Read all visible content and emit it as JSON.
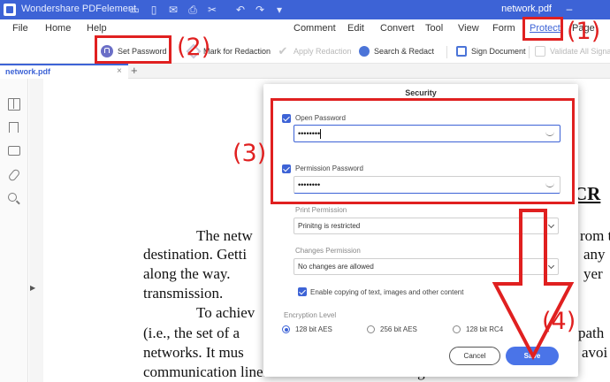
{
  "window": {
    "app_title": "Wondershare PDFelement",
    "doc_title": "network.pdf",
    "quick_access_icons": [
      "folder-icon",
      "save-icon",
      "mail-icon",
      "print-icon",
      "cut-icon",
      "undo-icon",
      "redo-icon",
      "customize-icon"
    ]
  },
  "menu": {
    "file": "File",
    "home": "Home",
    "help": "Help",
    "comment": "Comment",
    "edit": "Edit",
    "convert": "Convert",
    "tool": "Tool",
    "view": "View",
    "form": "Form",
    "protect": "Protect",
    "page": "Page"
  },
  "toolbar": {
    "set_password": "Set Password",
    "mark_redaction": "Mark for Redaction",
    "apply_redaction": "Apply Redaction",
    "search_redact": "Search & Redact",
    "sign_document": "Sign Document",
    "validate_signatures": "Validate All Signa"
  },
  "tabs": {
    "active_doc": "network.pdf",
    "close": "×",
    "add": "+"
  },
  "document": {
    "heading_fragment": "CR",
    "lines": [
      "The netw",
      "destination. Getti",
      "along  the  way.",
      "transmission.",
      "To achiev",
      "(i.e., the set of a",
      "networks. It mus",
      "communication lines and routers while leaving others idle."
    ],
    "right_fragments": [
      "rom t",
      "any",
      "yer",
      "path",
      "avoi"
    ]
  },
  "dialog": {
    "title": "Security",
    "open_password": {
      "label": "Open Password",
      "value": "••••••••"
    },
    "permission_password": {
      "label": "Permission Password",
      "value": "••••••••"
    },
    "print_permission": {
      "label": "Print Permission",
      "value": "Prinitng is restricted"
    },
    "changes_permission": {
      "label": "Changes Permission",
      "value": "No changes are allowed"
    },
    "copy_option": "Enable copying of text, images and other content",
    "encryption": {
      "label": "Encryption Level",
      "options": [
        "128 bit AES",
        "256 bit AES",
        "128 bit RC4"
      ],
      "selected": "128 bit AES"
    },
    "cancel": "Cancel",
    "save": "Save"
  },
  "annotations": {
    "step1": "(1)",
    "step2": "(2)",
    "step3": "(3)",
    "step4": "(4)",
    "color": "#e02020"
  }
}
